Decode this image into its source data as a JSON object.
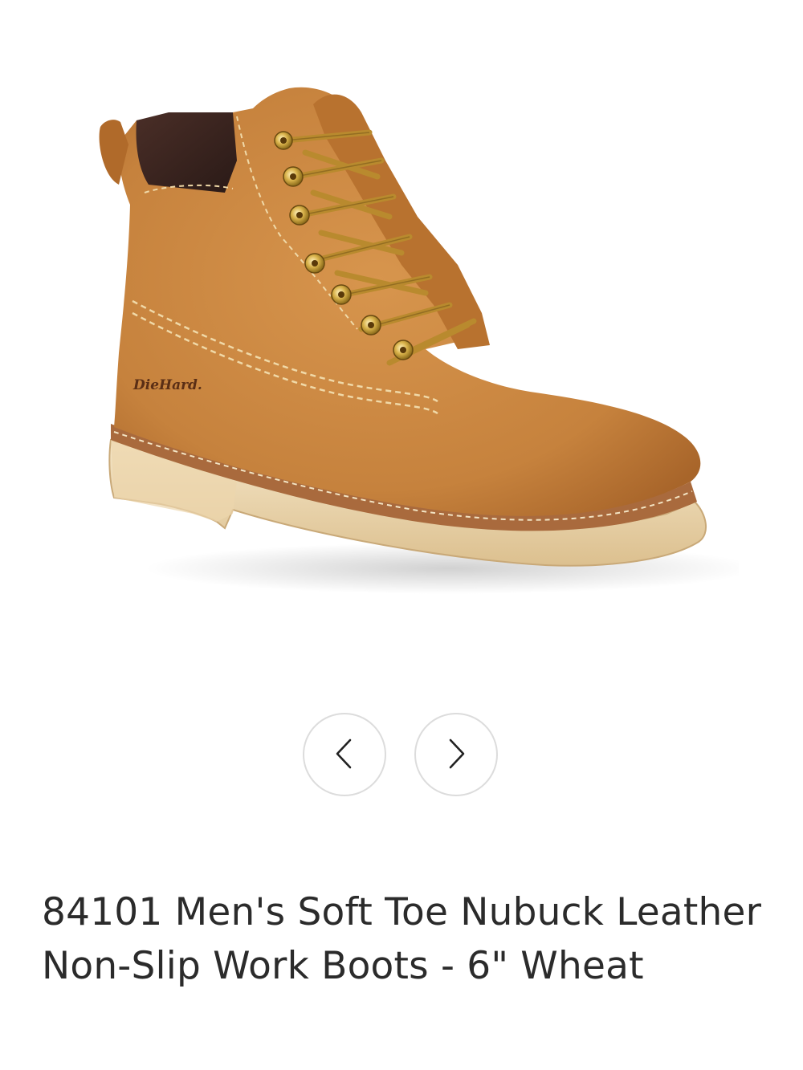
{
  "product": {
    "title": "84101 Men's Soft Toe Nubuck Leather Non-Slip Work Boots - 6\" Wheat",
    "image_icon": "work-boot-image",
    "brand_mark": "DieHard.",
    "colors": {
      "leather": "#c9863f",
      "sole": "#efd9b0",
      "welt": "#a96a3d",
      "collar_pad": "#3a2420",
      "lace": "#b98a2e",
      "eyelet": "#d9b24a"
    }
  },
  "carousel": {
    "prev_icon": "chevron-left-icon",
    "next_icon": "chevron-right-icon",
    "button_border": "#dcdcdc"
  }
}
